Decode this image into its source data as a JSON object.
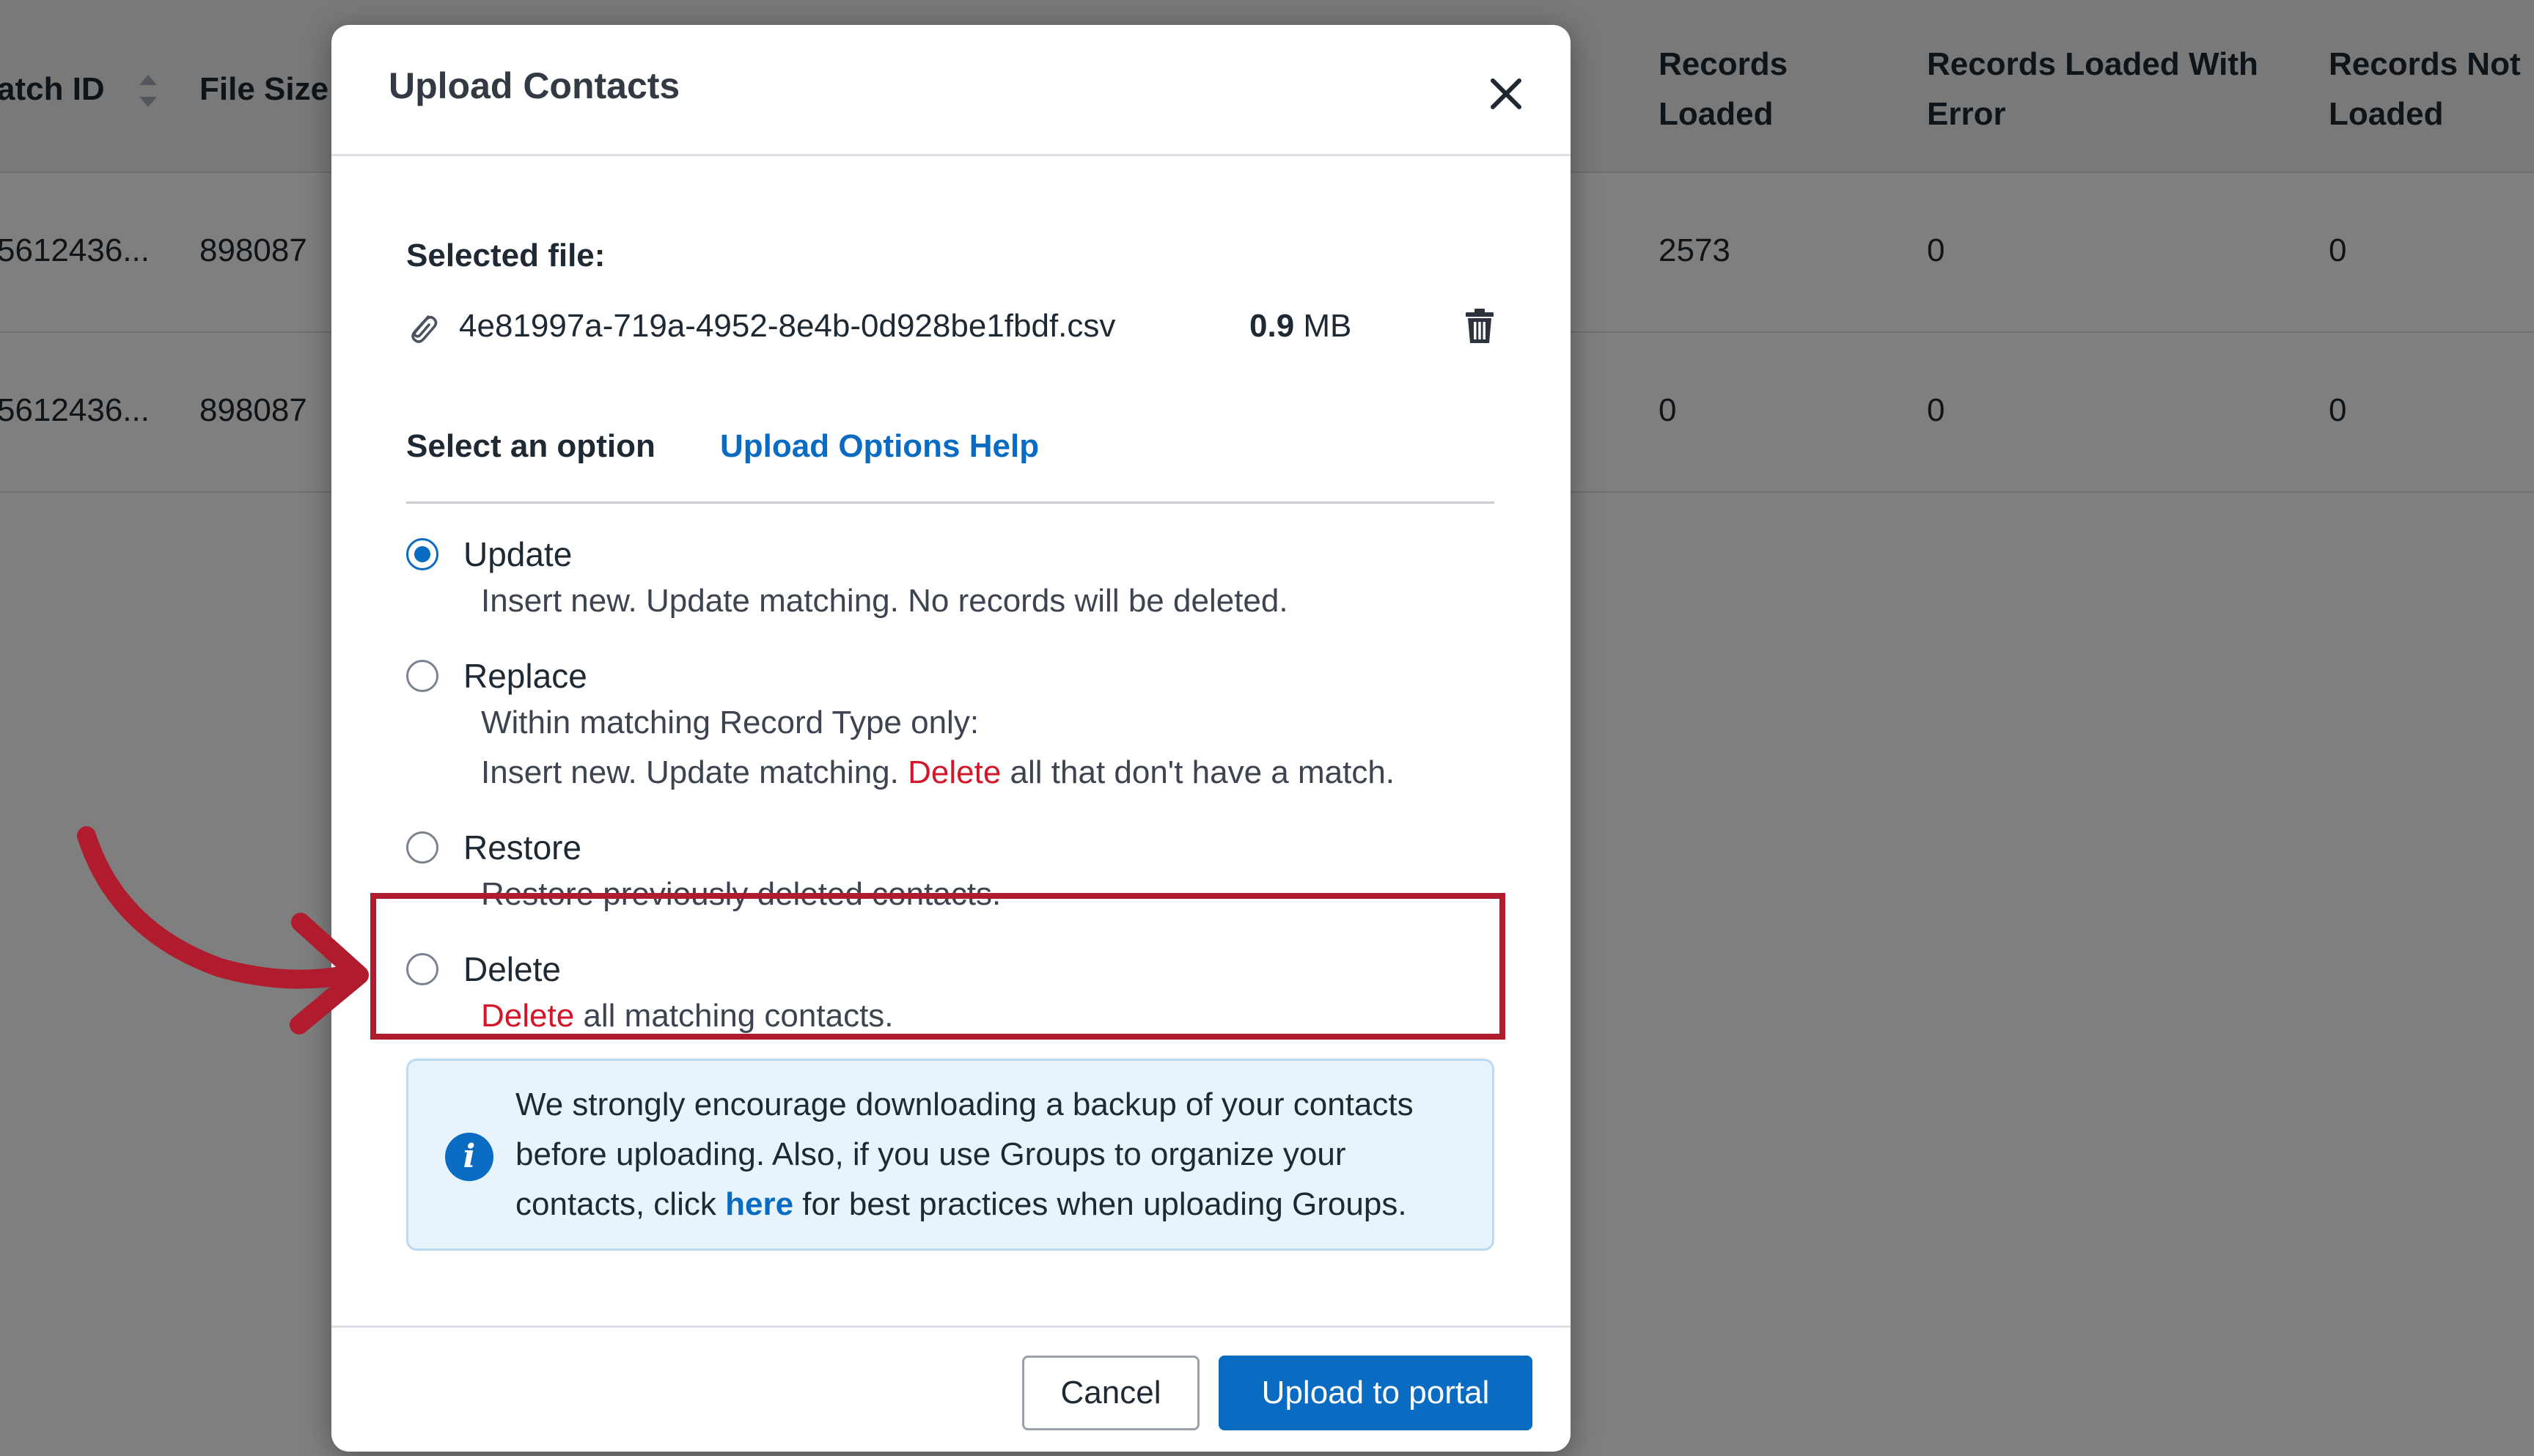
{
  "background_table": {
    "columns": [
      "atch ID",
      "File Size",
      "Records Loaded",
      "Records Loaded With Error",
      "Records Not Loaded"
    ],
    "rows": [
      [
        "5612436...",
        "898087",
        "2573",
        "0",
        "0"
      ],
      [
        "5612436...",
        "898087",
        "0",
        "0",
        "0"
      ]
    ]
  },
  "modal": {
    "title": "Upload Contacts",
    "close_icon": "close-icon",
    "selected_file_label": "Selected file:",
    "file": {
      "name": "4e81997a-719a-4952-8e4b-0d928be1fbdf.csv",
      "size_value": "0.9",
      "size_unit": "MB",
      "attach_icon": "paperclip-icon",
      "delete_icon": "trash-icon"
    },
    "select_option_label": "Select an option",
    "help_link": "Upload Options Help",
    "options": [
      {
        "label": "Update",
        "checked": true,
        "desc": "Insert new. Update matching. No records will be deleted."
      },
      {
        "label": "Replace",
        "checked": false,
        "desc_line1": "Within matching Record Type only:",
        "desc_line2_pre": "Insert new. Update matching.",
        "desc_line2_danger": "Delete",
        "desc_line2_post": "all that don't have a match."
      },
      {
        "label": "Restore",
        "checked": false,
        "desc": "Restore previously deleted contacts."
      },
      {
        "label": "Delete",
        "checked": false,
        "desc_danger": "Delete",
        "desc_post": "all matching contacts."
      }
    ],
    "info": {
      "icon": "info-icon",
      "text_pre": "We strongly encourage downloading a backup of your contacts before uploading. Also, if you use Groups to organize your contacts, click",
      "link": "here",
      "text_post": "for best practices when uploading Groups."
    },
    "buttons": {
      "cancel": "Cancel",
      "upload": "Upload to portal"
    }
  },
  "colors": {
    "primary": "#0a6bc2",
    "danger": "#d3162a",
    "annotation": "#b01c2e",
    "info_bg": "#e8f4fb"
  }
}
